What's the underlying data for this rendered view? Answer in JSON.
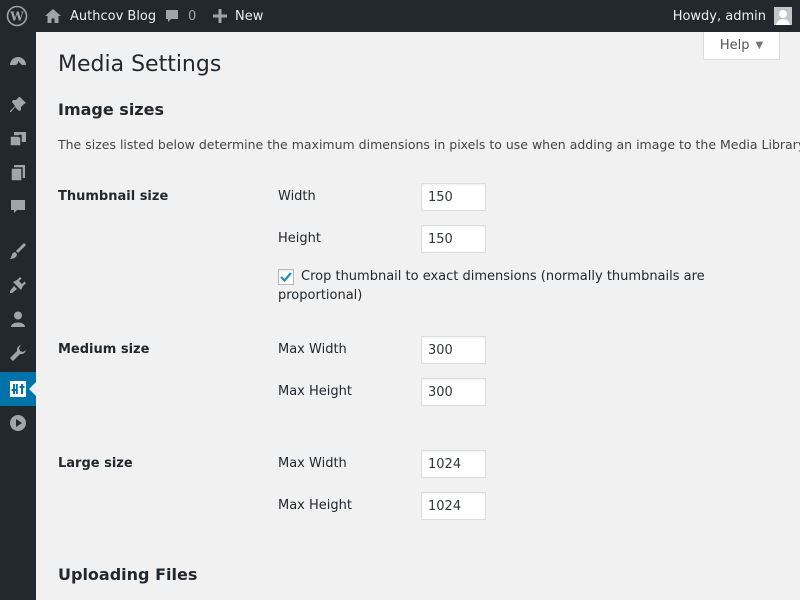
{
  "adminbar": {
    "site_name": "Authcov Blog",
    "comments_count": "0",
    "new_label": "New",
    "account_greeting": "Howdy, admin"
  },
  "sidebar": {
    "items": [
      {
        "icon": "dashboard-icon"
      },
      {
        "icon": "pin-icon"
      },
      {
        "icon": "media-icon"
      },
      {
        "icon": "pages-icon"
      },
      {
        "icon": "comments-icon"
      },
      {
        "icon": "appearance-icon"
      },
      {
        "icon": "plugins-icon"
      },
      {
        "icon": "users-icon"
      },
      {
        "icon": "tools-icon"
      },
      {
        "icon": "settings-icon",
        "current": true
      },
      {
        "icon": "play-icon"
      }
    ]
  },
  "help": {
    "label": "Help"
  },
  "page": {
    "title": "Media Settings",
    "image_sizes_title": "Image sizes",
    "image_sizes_desc": "The sizes listed below determine the maximum dimensions in pixels to use when adding an image to the Media Library.",
    "uploading_title": "Uploading Files"
  },
  "thumbnail": {
    "label": "Thumbnail size",
    "width_label": "Width",
    "width_value": "150",
    "height_label": "Height",
    "height_value": "150",
    "crop_checked": true,
    "crop_label": "Crop thumbnail to exact dimensions (normally thumbnails are proportional)"
  },
  "medium": {
    "label": "Medium size",
    "width_label": "Max Width",
    "width_value": "300",
    "height_label": "Max Height",
    "height_value": "300"
  },
  "large": {
    "label": "Large size",
    "width_label": "Max Width",
    "width_value": "1024",
    "height_label": "Max Height",
    "height_value": "1024"
  },
  "colors": {
    "adminbar_bg": "#23282d",
    "sidebar_bg": "#23282d",
    "accent": "#0073aa",
    "page_bg": "#f1f1f1",
    "checkmark": "#1e8cbe"
  }
}
